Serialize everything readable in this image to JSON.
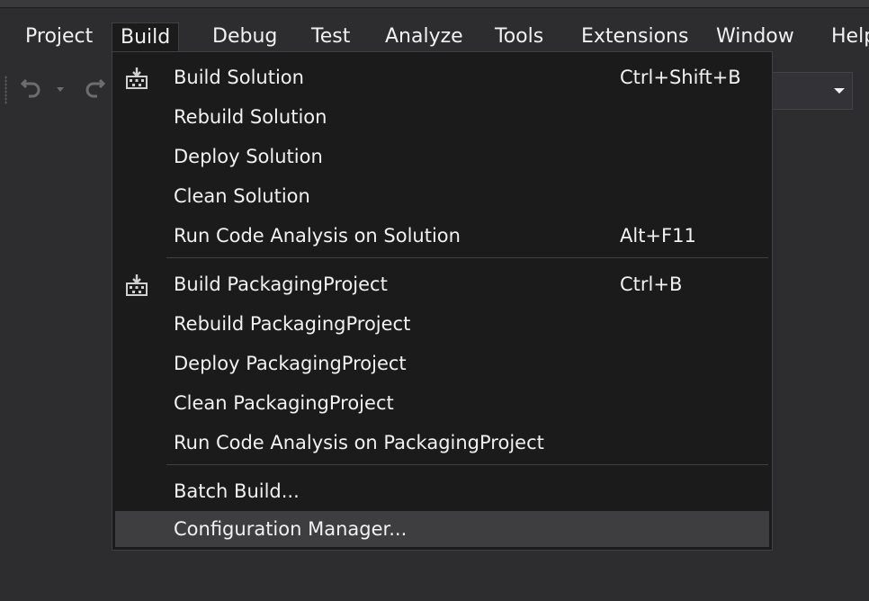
{
  "menubar": {
    "items": [
      {
        "label": "Project"
      },
      {
        "label": "Build"
      },
      {
        "label": "Debug"
      },
      {
        "label": "Test"
      },
      {
        "label": "Analyze"
      },
      {
        "label": "Tools"
      },
      {
        "label": "Extensions"
      },
      {
        "label": "Window"
      },
      {
        "label": "Help"
      }
    ],
    "active": "Build"
  },
  "toolbar": {
    "icons": [
      "undo-icon",
      "dropdown-arrow-icon",
      "redo-icon"
    ]
  },
  "build_menu": {
    "groups": [
      [
        {
          "label": "Build Solution",
          "shortcut": "Ctrl+Shift+B",
          "icon": "build-icon"
        },
        {
          "label": "Rebuild Solution",
          "shortcut": ""
        },
        {
          "label": "Deploy Solution",
          "shortcut": ""
        },
        {
          "label": "Clean Solution",
          "shortcut": ""
        },
        {
          "label": "Run Code Analysis on Solution",
          "shortcut": "Alt+F11"
        }
      ],
      [
        {
          "label": "Build PackagingProject",
          "shortcut": "Ctrl+B",
          "icon": "build-icon"
        },
        {
          "label": "Rebuild PackagingProject",
          "shortcut": ""
        },
        {
          "label": "Deploy PackagingProject",
          "shortcut": ""
        },
        {
          "label": "Clean PackagingProject",
          "shortcut": ""
        },
        {
          "label": "Run Code Analysis on PackagingProject",
          "shortcut": ""
        }
      ],
      [
        {
          "label": "Batch Build...",
          "shortcut": ""
        },
        {
          "label": "Configuration Manager...",
          "shortcut": "",
          "highlighted": true
        }
      ]
    ]
  },
  "colors": {
    "background": "#2d2d30",
    "menu_background": "#1b1b1c",
    "menu_border": "#3f3f46",
    "highlight": "#3e3e40",
    "text": "#f1f1f1"
  }
}
